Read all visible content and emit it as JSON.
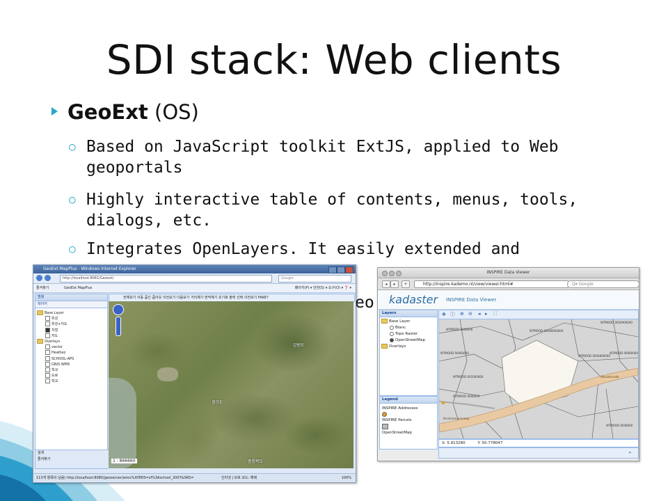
{
  "slide": {
    "title": "SDI stack: Web clients",
    "bullet": {
      "name": "GeoExt",
      "suffix": " (OS)"
    },
    "subbullets": [
      "Based on JavaScript toolkit ExtJS, applied to Web geoportals",
      "Highly interactive table of contents, menus, tools, dialogs, etc.",
      "Integrates OpenLayers. It easily extended and"
    ],
    "hidden_fragment": "eo"
  },
  "geoext_window": {
    "title": "GeoExt MapPlus - Windows Internet Explorer",
    "address": "http://localhost:8081/Geoext/",
    "search_placeholder": "Google",
    "favorites_label": "즐겨찾기",
    "tab_title": "GeoExt MapPlus",
    "toolbar_items": "페이지(P) ▾  안전(S) ▾  도구(O) ▾  ❓ ▾",
    "panel_title": "범례",
    "panel_subtitle": "레이어",
    "map_tools": "전체보기  이동  줌인  줌아웃  이전보기  다음보기  거리재기  면적재기  초기화  출력  선택  이전보기  FAKE?",
    "tree": {
      "base_layer": "Base Layer",
      "base_items": [
        "위성",
        "위성+지도",
        "지형",
        "지도"
      ],
      "overlays": "Overlays",
      "overlay_items": [
        "vector",
        "Healtiez",
        "SCHOOL-APS",
        "GNIS WMS",
        "학교",
        "도로",
        "학교"
      ]
    },
    "panel_bottom": [
      "검색",
      "즐겨찾기"
    ],
    "map_labels": {
      "gangwon": "강원도",
      "gyeonggi": "경기도",
      "chungbuk": "충청북도",
      "scale": "1 : 866660"
    },
    "status": "113개 항목이 남음) http://localhost:8080/geoserver/wms?LAYERS=sf%3Aschool_2007&SRS=",
    "status_right": "인터넷 | 보호 모드: 해제",
    "zoom_level": "100%"
  },
  "inspire_window": {
    "title": "INSPIRE Data Viewer",
    "url": "http://inspire.kademo.nl/view/viewer.html#",
    "search_placeholder": "Q▾ Google",
    "logo": "kadaster",
    "app_title": "INSPIRE Data Viewer",
    "layers_title": "Layers",
    "tree": {
      "base_layer": "Base Layer",
      "base_items": [
        "Blanc",
        "Topo Raster",
        "OpenStreetMap"
      ],
      "overlays": "Overlays"
    },
    "legend_title": "Legend",
    "legend_items": [
      "INSPIRE Addresses",
      "INSPIRE Parcels",
      "OpenStreetMap"
    ],
    "coords": {
      "x": "X: 5.913280",
      "y": "Y: 50.778047"
    },
    "map_labels": {
      "wt1": "WTMOOD 1000000",
      "wt2": "WTMOOD 04083000",
      "wt3": "WTMOOD 04048000000",
      "wt4": "WTMOOD 00S4900000",
      "wt5": "WTMOOD 00000000",
      "wt6": "WTMOOD 00S4800000",
      "wt7": "WTMOOD 001000000",
      "wt8": "WTMOOD 0000000",
      "wt9": "WTMOOD 0048000",
      "road1": "Weustenrade",
      "road2": "Kerdeskeumerweg"
    },
    "collapse_icon_text": "«"
  }
}
